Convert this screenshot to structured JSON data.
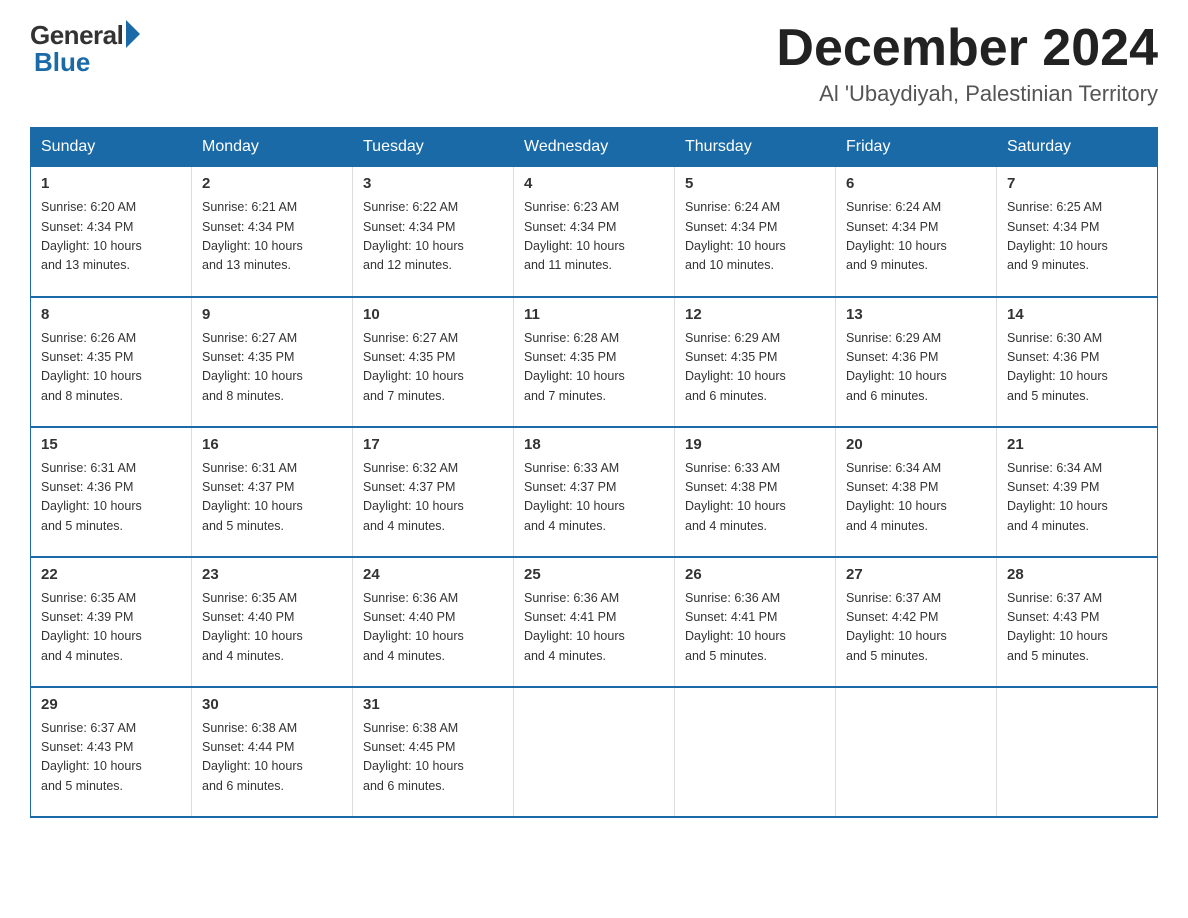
{
  "logo": {
    "general": "General",
    "blue": "Blue"
  },
  "header": {
    "month": "December 2024",
    "location": "Al 'Ubaydiyah, Palestinian Territory"
  },
  "days_header": [
    "Sunday",
    "Monday",
    "Tuesday",
    "Wednesday",
    "Thursday",
    "Friday",
    "Saturday"
  ],
  "weeks": [
    [
      {
        "day": "1",
        "sunrise": "6:20 AM",
        "sunset": "4:34 PM",
        "daylight": "10 hours and 13 minutes."
      },
      {
        "day": "2",
        "sunrise": "6:21 AM",
        "sunset": "4:34 PM",
        "daylight": "10 hours and 13 minutes."
      },
      {
        "day": "3",
        "sunrise": "6:22 AM",
        "sunset": "4:34 PM",
        "daylight": "10 hours and 12 minutes."
      },
      {
        "day": "4",
        "sunrise": "6:23 AM",
        "sunset": "4:34 PM",
        "daylight": "10 hours and 11 minutes."
      },
      {
        "day": "5",
        "sunrise": "6:24 AM",
        "sunset": "4:34 PM",
        "daylight": "10 hours and 10 minutes."
      },
      {
        "day": "6",
        "sunrise": "6:24 AM",
        "sunset": "4:34 PM",
        "daylight": "10 hours and 9 minutes."
      },
      {
        "day": "7",
        "sunrise": "6:25 AM",
        "sunset": "4:34 PM",
        "daylight": "10 hours and 9 minutes."
      }
    ],
    [
      {
        "day": "8",
        "sunrise": "6:26 AM",
        "sunset": "4:35 PM",
        "daylight": "10 hours and 8 minutes."
      },
      {
        "day": "9",
        "sunrise": "6:27 AM",
        "sunset": "4:35 PM",
        "daylight": "10 hours and 8 minutes."
      },
      {
        "day": "10",
        "sunrise": "6:27 AM",
        "sunset": "4:35 PM",
        "daylight": "10 hours and 7 minutes."
      },
      {
        "day": "11",
        "sunrise": "6:28 AM",
        "sunset": "4:35 PM",
        "daylight": "10 hours and 7 minutes."
      },
      {
        "day": "12",
        "sunrise": "6:29 AM",
        "sunset": "4:35 PM",
        "daylight": "10 hours and 6 minutes."
      },
      {
        "day": "13",
        "sunrise": "6:29 AM",
        "sunset": "4:36 PM",
        "daylight": "10 hours and 6 minutes."
      },
      {
        "day": "14",
        "sunrise": "6:30 AM",
        "sunset": "4:36 PM",
        "daylight": "10 hours and 5 minutes."
      }
    ],
    [
      {
        "day": "15",
        "sunrise": "6:31 AM",
        "sunset": "4:36 PM",
        "daylight": "10 hours and 5 minutes."
      },
      {
        "day": "16",
        "sunrise": "6:31 AM",
        "sunset": "4:37 PM",
        "daylight": "10 hours and 5 minutes."
      },
      {
        "day": "17",
        "sunrise": "6:32 AM",
        "sunset": "4:37 PM",
        "daylight": "10 hours and 4 minutes."
      },
      {
        "day": "18",
        "sunrise": "6:33 AM",
        "sunset": "4:37 PM",
        "daylight": "10 hours and 4 minutes."
      },
      {
        "day": "19",
        "sunrise": "6:33 AM",
        "sunset": "4:38 PM",
        "daylight": "10 hours and 4 minutes."
      },
      {
        "day": "20",
        "sunrise": "6:34 AM",
        "sunset": "4:38 PM",
        "daylight": "10 hours and 4 minutes."
      },
      {
        "day": "21",
        "sunrise": "6:34 AM",
        "sunset": "4:39 PM",
        "daylight": "10 hours and 4 minutes."
      }
    ],
    [
      {
        "day": "22",
        "sunrise": "6:35 AM",
        "sunset": "4:39 PM",
        "daylight": "10 hours and 4 minutes."
      },
      {
        "day": "23",
        "sunrise": "6:35 AM",
        "sunset": "4:40 PM",
        "daylight": "10 hours and 4 minutes."
      },
      {
        "day": "24",
        "sunrise": "6:36 AM",
        "sunset": "4:40 PM",
        "daylight": "10 hours and 4 minutes."
      },
      {
        "day": "25",
        "sunrise": "6:36 AM",
        "sunset": "4:41 PM",
        "daylight": "10 hours and 4 minutes."
      },
      {
        "day": "26",
        "sunrise": "6:36 AM",
        "sunset": "4:41 PM",
        "daylight": "10 hours and 5 minutes."
      },
      {
        "day": "27",
        "sunrise": "6:37 AM",
        "sunset": "4:42 PM",
        "daylight": "10 hours and 5 minutes."
      },
      {
        "day": "28",
        "sunrise": "6:37 AM",
        "sunset": "4:43 PM",
        "daylight": "10 hours and 5 minutes."
      }
    ],
    [
      {
        "day": "29",
        "sunrise": "6:37 AM",
        "sunset": "4:43 PM",
        "daylight": "10 hours and 5 minutes."
      },
      {
        "day": "30",
        "sunrise": "6:38 AM",
        "sunset": "4:44 PM",
        "daylight": "10 hours and 6 minutes."
      },
      {
        "day": "31",
        "sunrise": "6:38 AM",
        "sunset": "4:45 PM",
        "daylight": "10 hours and 6 minutes."
      },
      null,
      null,
      null,
      null
    ]
  ],
  "labels": {
    "sunrise": "Sunrise:",
    "sunset": "Sunset:",
    "daylight": "Daylight:"
  }
}
